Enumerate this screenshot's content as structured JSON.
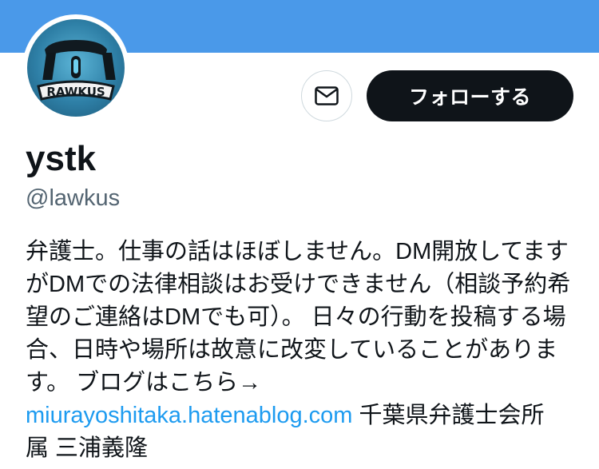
{
  "profile": {
    "display_name": "ystk",
    "handle": "@lawkus",
    "avatar_text": "RAWKUS"
  },
  "actions": {
    "message_icon": "envelope-icon",
    "follow_label": "フォローする"
  },
  "bio": {
    "line1": "弁護士。仕事の話はほぼしません。DM開放してます",
    "line2": "がDMでの法律相談はお受けできません（相談予約希",
    "line3": "望のご連絡はDMでも可）。 日々の行動を投稿する場",
    "line4": "合、日時や場所は故意に改変していることがありま",
    "line5": "す。 ブログはこちら→",
    "link": "miurayoshitaka.hatenablog.com",
    "line6_suffix": " 千葉県弁護士会所",
    "line7": "属 三浦義隆"
  },
  "colors": {
    "banner": "#4a99e9",
    "follow_bg": "#0f1419",
    "link": "#1d9bf0",
    "handle": "#536471"
  }
}
